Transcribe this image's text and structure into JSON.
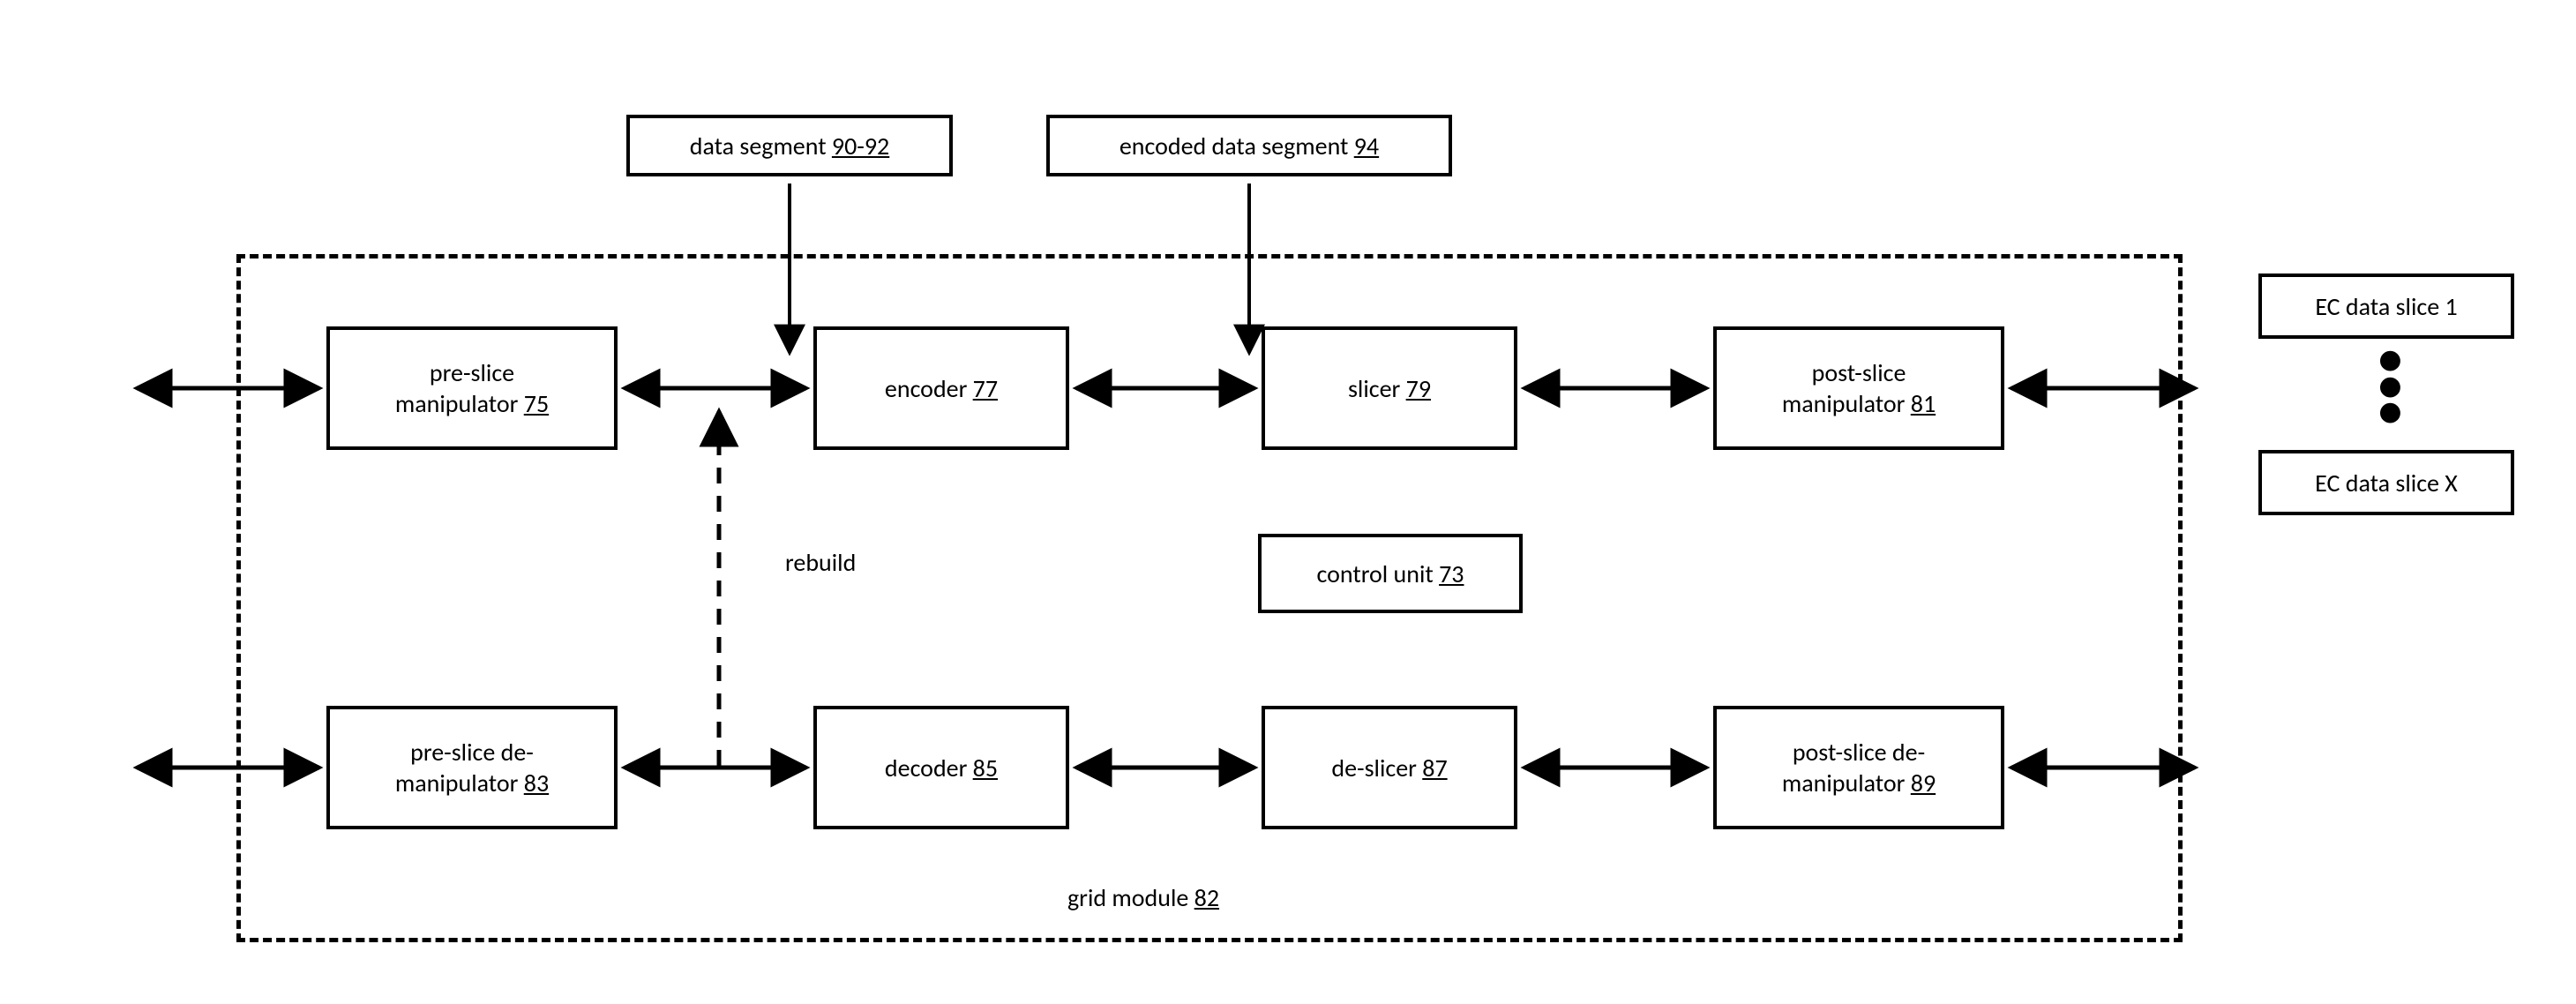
{
  "chart_data": {
    "type": "block-diagram",
    "module": "grid module 82",
    "top_path": [
      "pre-slice manipulator 75",
      "encoder 77",
      "slicer 79",
      "post-slice manipulator 81"
    ],
    "bottom_path": [
      "pre-slice de-manipulator 83",
      "decoder 85",
      "de-slicer 87",
      "post-slice de-manipulator 89"
    ],
    "center_block": "control unit 73",
    "top_inputs": [
      "data segment 90-92",
      "encoded data segment 94"
    ],
    "outputs": [
      "EC data slice 1",
      "EC data slice X"
    ],
    "vertical_link": "rebuild"
  },
  "top": {
    "data_segment_prefix": "data segment ",
    "data_segment_ref": "90-92",
    "encoded_prefix": "encoded data segment ",
    "encoded_ref": "94"
  },
  "row1": {
    "preslice_l1": "pre-slice",
    "preslice_l2a": "manipulator ",
    "preslice_l2b": "75",
    "encoder_a": "encoder ",
    "encoder_b": "77",
    "slicer_a": "slicer ",
    "slicer_b": "79",
    "postslice_l1": "post-slice",
    "postslice_l2a": "manipulator ",
    "postslice_l2b": "81"
  },
  "mid": {
    "rebuild": "rebuild",
    "control_a": "control unit ",
    "control_b": "73"
  },
  "row2": {
    "preslice_l1": "pre-slice de-",
    "preslice_l2a": "manipulator ",
    "preslice_l2b": "83",
    "decoder_a": "decoder ",
    "decoder_b": "85",
    "deslicer_a": "de-slicer ",
    "deslicer_b": "87",
    "postslice_l1": "post-slice de-",
    "postslice_l2a": "manipulator ",
    "postslice_l2b": "89"
  },
  "footer": {
    "grid_a": "grid module ",
    "grid_b": "82"
  },
  "right": {
    "slice1": "EC  data slice 1",
    "sliceX": "EC data slice X"
  }
}
